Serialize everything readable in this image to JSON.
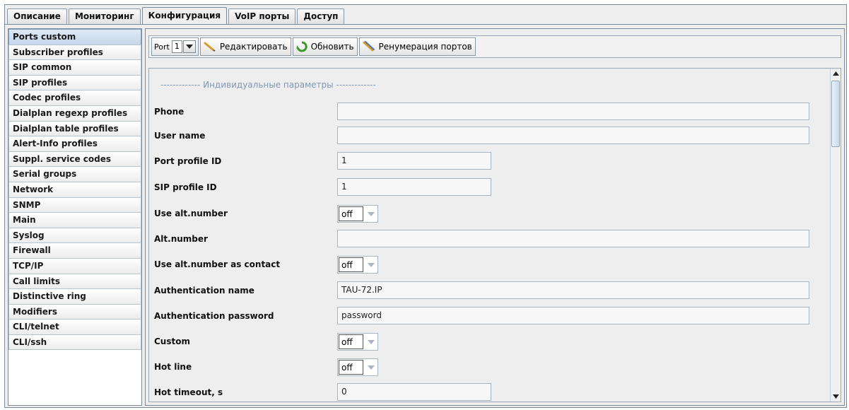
{
  "tabs": [
    {
      "label": "Описание"
    },
    {
      "label": "Мониторинг"
    },
    {
      "label": "Конфигурация"
    },
    {
      "label": "VoIP порты"
    },
    {
      "label": "Доступ"
    }
  ],
  "active_tab": "Конфигурация",
  "sidebar": {
    "items": [
      {
        "label": "Ports custom"
      },
      {
        "label": "Subscriber profiles"
      },
      {
        "label": "SIP common"
      },
      {
        "label": "SIP profiles"
      },
      {
        "label": "Codec profiles"
      },
      {
        "label": "Dialplan regexp profiles"
      },
      {
        "label": "Dialplan table profiles"
      },
      {
        "label": "Alert-Info profiles"
      },
      {
        "label": "Suppl. service codes"
      },
      {
        "label": "Serial groups"
      },
      {
        "label": "Network"
      },
      {
        "label": "SNMP"
      },
      {
        "label": "Main"
      },
      {
        "label": "Syslog"
      },
      {
        "label": "Firewall"
      },
      {
        "label": "TCP/IP"
      },
      {
        "label": "Call limits"
      },
      {
        "label": "Distinctive ring"
      },
      {
        "label": "Modifiers"
      },
      {
        "label": "CLI/telnet"
      },
      {
        "label": "CLI/ssh"
      }
    ],
    "active": "Ports custom"
  },
  "toolbar": {
    "port_label": "Port",
    "port_value": "1",
    "edit_label": "Редактировать",
    "refresh_label": "Обновить",
    "renumber_label": "Ренумерация портов"
  },
  "form": {
    "section_title": "------------- Индивидуальные параметры -------------",
    "rows": [
      {
        "label": "Phone",
        "value": ""
      },
      {
        "label": "User name",
        "value": ""
      },
      {
        "label": "Port profile ID",
        "value": "1"
      },
      {
        "label": "SIP profile ID",
        "value": "1"
      },
      {
        "label": "Use alt.number",
        "value": "off"
      },
      {
        "label": "Alt.number",
        "value": ""
      },
      {
        "label": "Use alt.number as contact",
        "value": "off"
      },
      {
        "label": "Authentication name",
        "value": "TAU-72.IP"
      },
      {
        "label": "Authentication password",
        "value": "password"
      },
      {
        "label": "Custom",
        "value": "off"
      },
      {
        "label": "Hot line",
        "value": "off"
      },
      {
        "label": "Hot timeout, s",
        "value": "0"
      }
    ]
  },
  "colors": {
    "accent": "#7f97b3",
    "border": "#7a8a99",
    "panel_bg": "#eeeeee"
  },
  "icons": {
    "edit": "pencil-icon",
    "refresh": "refresh-icon",
    "renumber": "renumber-pencil-icon"
  }
}
